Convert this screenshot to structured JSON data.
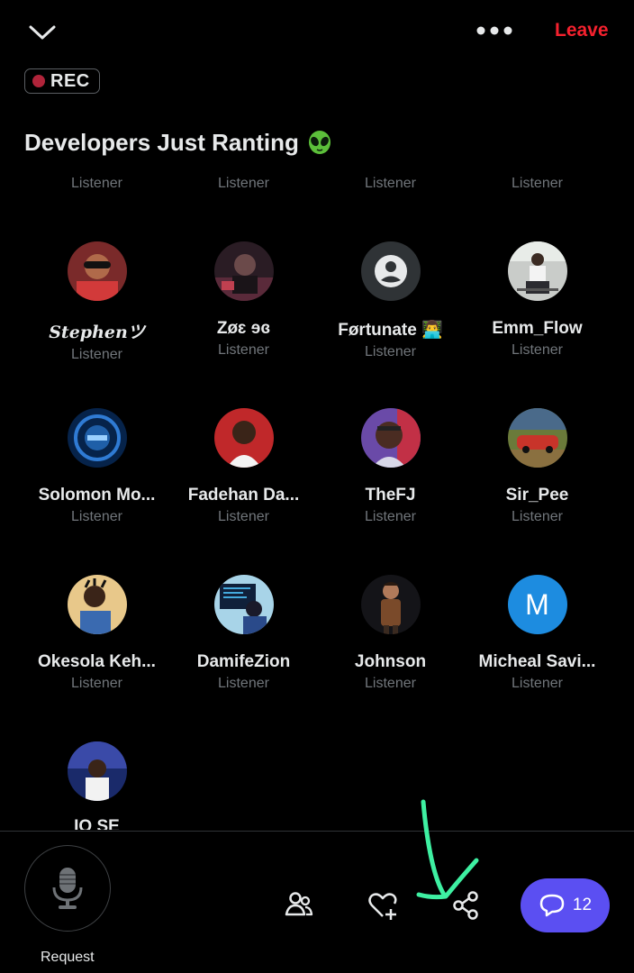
{
  "header": {
    "leave_label": "Leave",
    "rec_label": "REC",
    "title": "Developers Just Ranting"
  },
  "role_label": "Listener",
  "top_row_roles": [
    "Listener",
    "Listener",
    "Listener",
    "Listener"
  ],
  "participants": [
    {
      "name": "𝑺𝒕𝒆𝒑𝒉𝒆𝒏ツ",
      "role": "Listener"
    },
    {
      "name": "Zøɛ ɘɞ",
      "role": "Listener"
    },
    {
      "name": "Førtunate 👨‍💻",
      "role": "Listener"
    },
    {
      "name": "Emm_Flow",
      "role": "Listener"
    },
    {
      "name": "Solomon Mo...",
      "role": "Listener"
    },
    {
      "name": "Fadehan Da...",
      "role": "Listener"
    },
    {
      "name": "TheFJ",
      "role": "Listener"
    },
    {
      "name": "Sir_Pee",
      "role": "Listener"
    },
    {
      "name": "Okesola Keh...",
      "role": "Listener"
    },
    {
      "name": "DamifeZion",
      "role": "Listener"
    },
    {
      "name": "Johnson",
      "role": "Listener"
    },
    {
      "name": "Micheal Savi...",
      "role": "Listener"
    },
    {
      "name": "IO SE",
      "role": ""
    }
  ],
  "avatar_letter_m": "M",
  "bottom": {
    "request_label": "Request",
    "chat_count": "12"
  },
  "colors": {
    "leave": "#f4212e",
    "chat_pill": "#5b4ff2",
    "annotation": "#3ef0a2"
  },
  "icons": [
    "chevron-down-icon",
    "more-icon",
    "alien-icon",
    "microphone-icon",
    "people-icon",
    "heart-plus-icon",
    "share-icon",
    "chat-bubble-icon",
    "default-avatar-icon"
  ]
}
